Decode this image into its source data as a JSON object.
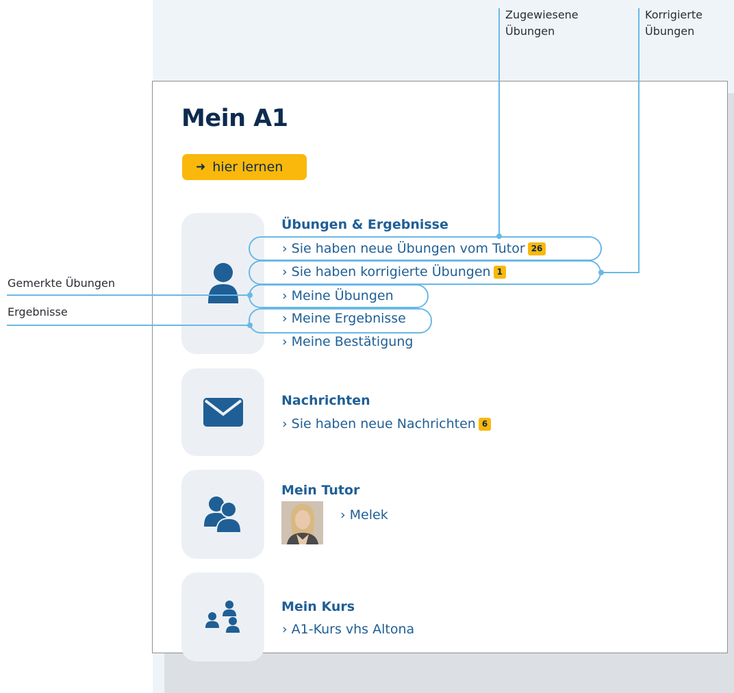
{
  "page": {
    "title": "Mein A1",
    "learn_button": {
      "arrow": "➜",
      "label": "hier lernen"
    }
  },
  "sections": {
    "exercises": {
      "title": "Übungen & Ergebnisse",
      "links": [
        {
          "label": "› Sie haben neue Übungen vom Tutor",
          "badge": "26"
        },
        {
          "label": "› Sie haben korrigierte Übungen",
          "badge": "1"
        },
        {
          "label": "› Meine Übungen"
        },
        {
          "label": "› Meine Ergebnisse"
        },
        {
          "label": "› Meine Bestätigung"
        }
      ]
    },
    "messages": {
      "title": "Nachrichten",
      "links": [
        {
          "label": "› Sie haben neue Nachrichten",
          "badge": "6"
        }
      ]
    },
    "tutor": {
      "title": "Mein Tutor",
      "name_link": "› Melek"
    },
    "course": {
      "title": "Mein Kurs",
      "link": "› A1-Kurs vhs Altona"
    }
  },
  "callouts": {
    "assigned": "Zugewiesene Übungen",
    "corrected": "Korrigierte Übungen",
    "bookmarked": "Gemerkte Übungen",
    "results": "Ergebnisse"
  },
  "icons": {
    "exercises": "user-icon",
    "messages": "envelope-icon",
    "tutor": "users-icon",
    "course": "group-icon"
  },
  "colors": {
    "accent_yellow": "#f9b80b",
    "link_blue": "#1f5f95",
    "title_navy": "#0d2b4e",
    "callout_line": "#6ab8e6",
    "tile_bg": "#ecf0f4"
  }
}
